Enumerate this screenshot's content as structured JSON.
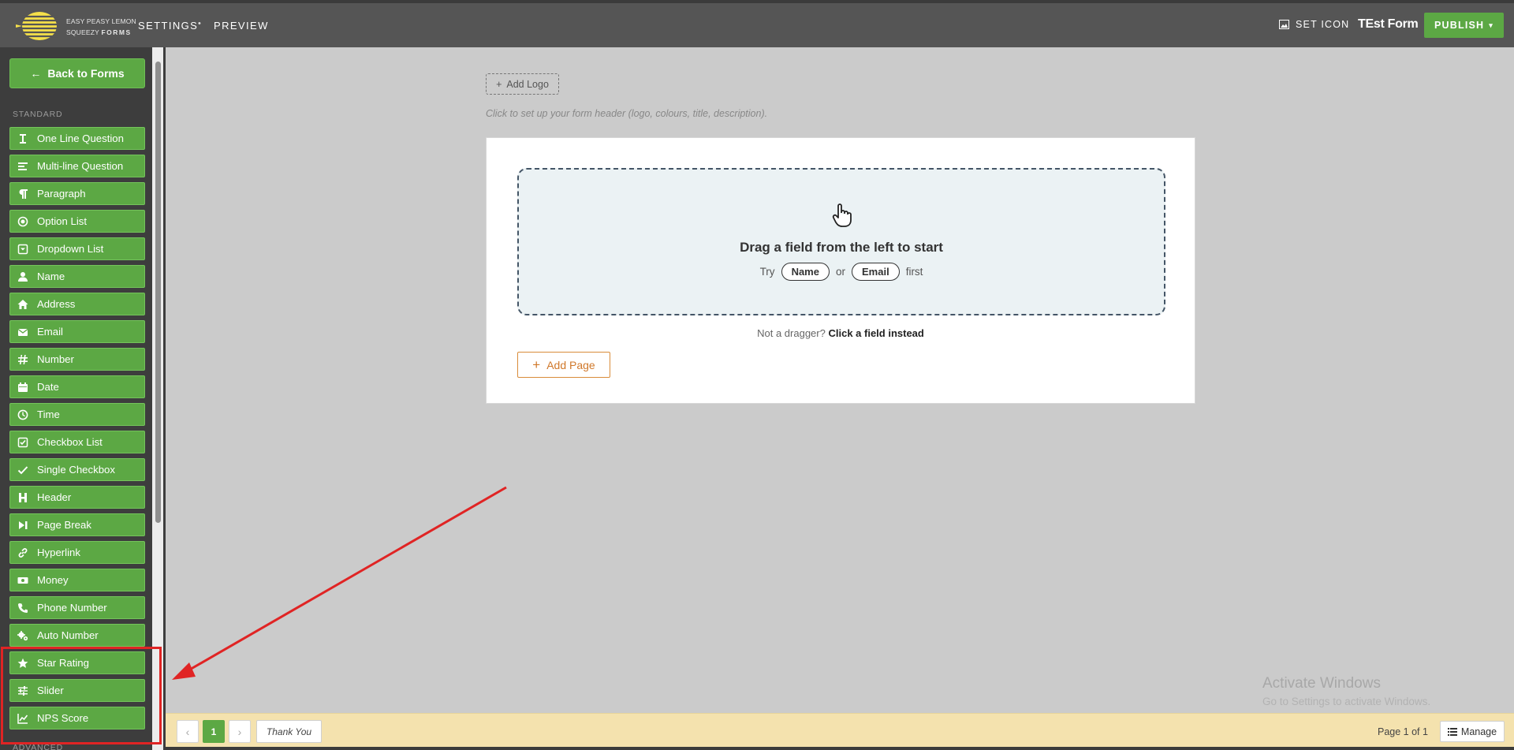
{
  "brand": {
    "line1": "EASY PEASY LEMON",
    "line2a": "SQUEEZY",
    "line2b": "FORMS"
  },
  "topnav": {
    "settings": "SETTINGS",
    "preview": "PREVIEW",
    "set_icon": "SET ICON",
    "form_title": "TEst Form",
    "publish": "PUBLISH"
  },
  "sidebar": {
    "back": "Back to Forms",
    "section_standard": "STANDARD",
    "section_advanced": "ADVANCED",
    "fields": [
      {
        "label": "One Line Question",
        "icon": "text-cursor-icon"
      },
      {
        "label": "Multi-line Question",
        "icon": "align-left-icon"
      },
      {
        "label": "Paragraph",
        "icon": "pilcrow-icon"
      },
      {
        "label": "Option List",
        "icon": "radio-icon"
      },
      {
        "label": "Dropdown List",
        "icon": "dropdown-icon"
      },
      {
        "label": "Name",
        "icon": "user-icon"
      },
      {
        "label": "Address",
        "icon": "home-icon"
      },
      {
        "label": "Email",
        "icon": "envelope-icon"
      },
      {
        "label": "Number",
        "icon": "hash-icon"
      },
      {
        "label": "Date",
        "icon": "calendar-icon"
      },
      {
        "label": "Time",
        "icon": "clock-icon"
      },
      {
        "label": "Checkbox List",
        "icon": "checkbox-icon"
      },
      {
        "label": "Single Checkbox",
        "icon": "check-icon"
      },
      {
        "label": "Header",
        "icon": "heading-icon"
      },
      {
        "label": "Page Break",
        "icon": "page-break-icon"
      },
      {
        "label": "Hyperlink",
        "icon": "link-icon"
      },
      {
        "label": "Money",
        "icon": "money-icon"
      },
      {
        "label": "Phone Number",
        "icon": "phone-icon"
      },
      {
        "label": "Auto Number",
        "icon": "gears-icon"
      },
      {
        "label": "Star Rating",
        "icon": "star-icon"
      },
      {
        "label": "Slider",
        "icon": "sliders-icon"
      },
      {
        "label": "NPS Score",
        "icon": "chart-line-icon"
      }
    ]
  },
  "canvas": {
    "add_logo": "Add Logo",
    "header_hint": "Click to set up your form header (logo, colours, title, description).",
    "drag_title": "Drag a field from the left to start",
    "try": "Try",
    "pill_name": "Name",
    "or": "or",
    "pill_email": "Email",
    "first": "first",
    "not_dragger": "Not a dragger?",
    "click_instead": "Click a field instead",
    "add_page": "Add Page"
  },
  "watermark": {
    "line1": "Activate Windows",
    "line2": "Go to Settings to activate Windows."
  },
  "bottombar": {
    "prev": "‹",
    "page_number": "1",
    "next": "›",
    "thank_you": "Thank You",
    "page_of": "Page 1 of 1",
    "manage": "Manage"
  },
  "colors": {
    "topbar": "#555555",
    "sidebar": "#3d3d3d",
    "green": "#5ca844",
    "canvas": "#cbcbcb",
    "bottombar": "#f4e2ae",
    "annotation_red": "#e02424"
  }
}
